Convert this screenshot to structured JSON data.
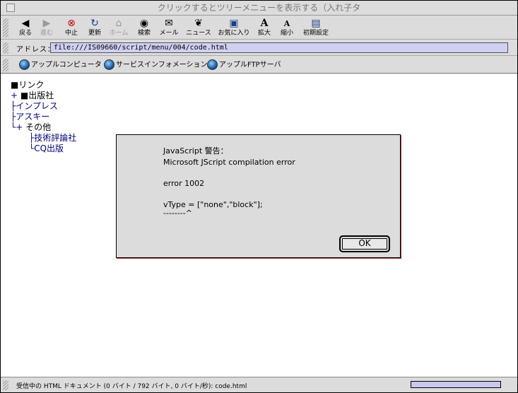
{
  "window": {
    "title": "クリックするとツリーメニューを表示する（入れ子タ"
  },
  "toolbar": {
    "back": "戻る",
    "forward": "進む",
    "stop": "中止",
    "refresh": "更新",
    "home": "ホーム",
    "search": "検索",
    "mail": "メール",
    "news": "ニュース",
    "favorites": "お気に入り",
    "larger": "拡大",
    "smaller": "縮小",
    "preferences": "初期設定"
  },
  "address": {
    "label": "アドレス：",
    "value": "file:///IS09660/script/menu/004/code.html"
  },
  "favorites_bar": {
    "items": [
      "アップルコンピュータ",
      "サービスインフォメーション",
      "アップルFTPサーバ"
    ]
  },
  "tree": {
    "root": "■リンク",
    "publishers": "■出版社",
    "publishers_prefix": "+",
    "impress": "├インプレス",
    "ascii": "├アスキー",
    "other_prefix": "└+",
    "other": "その他",
    "gihyo": "├技術評論社",
    "cq": "└CQ出版"
  },
  "dialog": {
    "heading": "JavaScript 警告：",
    "line1": "Microsoft JScript compilation error",
    "line2": "error 1002",
    "line3": "vType = [\"none\",\"block\"];",
    "line4": "--------^",
    "ok_label": "OK"
  },
  "status": {
    "text": "受信中の HTML ドキュメント (0 バイト / 792 バイト, 0 バイト/秒): code.html"
  }
}
